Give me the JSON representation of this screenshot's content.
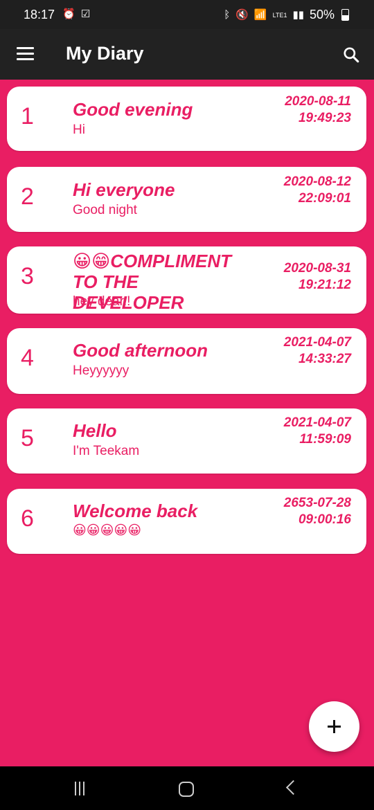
{
  "status_bar": {
    "time": "18:17",
    "battery": "50%",
    "network": "LTE1",
    "icons": [
      "alarm-icon",
      "checkbox-icon",
      "bluetooth-icon",
      "mute-icon",
      "wifi-icon",
      "signal-icon",
      "battery-icon"
    ]
  },
  "app_bar": {
    "title": "My Diary",
    "menu_icon": "menu-icon",
    "search_icon": "search-icon"
  },
  "entries": [
    {
      "number": "1",
      "title": "Good evening",
      "body": "Hi",
      "date": "2020-08-11",
      "time": "19:49:23"
    },
    {
      "number": "2",
      "title": "Hi everyone",
      "body": "Good night",
      "date": "2020-08-12",
      "time": "22:09:01"
    },
    {
      "number": "3",
      "title": "😀😁COMPLIMENT TO THE DEVELOPER",
      "body": "hey dear.!",
      "date": "2020-08-31",
      "time": "19:21:12"
    },
    {
      "number": "4",
      "title": "Good afternoon",
      "body": "Heyyyyyy",
      "date": "2021-04-07",
      "time": "14:33:27"
    },
    {
      "number": "5",
      "title": "Hello",
      "body": "I'm Teekam",
      "date": "2021-04-07",
      "time": "11:59:09"
    },
    {
      "number": "6",
      "title": "Welcome back",
      "body": "😀😀😀😀😀",
      "date": "2653-07-28",
      "time": "09:00:16"
    }
  ],
  "fab": {
    "icon": "plus-icon"
  },
  "nav_bar": {
    "icons": [
      "recents-icon",
      "home-icon",
      "back-icon"
    ]
  },
  "colors": {
    "accent": "#E91E63",
    "app_bar": "#222222",
    "card": "#FFFFFF"
  }
}
